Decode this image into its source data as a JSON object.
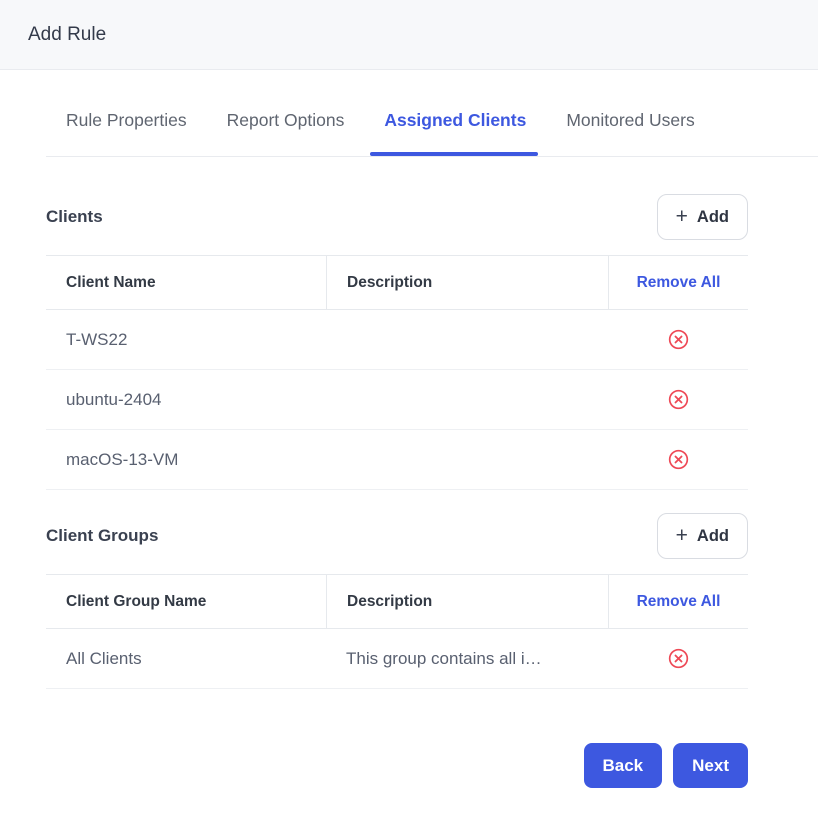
{
  "header": {
    "title": "Add Rule"
  },
  "tabs": [
    {
      "label": "Rule Properties",
      "active": false
    },
    {
      "label": "Report Options",
      "active": false
    },
    {
      "label": "Assigned Clients",
      "active": true
    },
    {
      "label": "Monitored Users",
      "active": false
    }
  ],
  "colors": {
    "accent": "#3d58e0",
    "danger": "#ee4956"
  },
  "clients_section": {
    "title": "Clients",
    "add_label": "Add",
    "plus_icon": "+",
    "table": {
      "columns": [
        "Client Name",
        "Description",
        "Remove All"
      ],
      "rows": [
        {
          "name": "T-WS22",
          "description": ""
        },
        {
          "name": "ubuntu-2404",
          "description": ""
        },
        {
          "name": "macOS-13-VM",
          "description": ""
        }
      ]
    }
  },
  "groups_section": {
    "title": "Client Groups",
    "add_label": "Add",
    "plus_icon": "+",
    "table": {
      "columns": [
        "Client Group Name",
        "Description",
        "Remove All"
      ],
      "rows": [
        {
          "name": "All Clients",
          "description": "This group contains all i…"
        }
      ]
    }
  },
  "footer": {
    "back_label": "Back",
    "next_label": "Next"
  }
}
